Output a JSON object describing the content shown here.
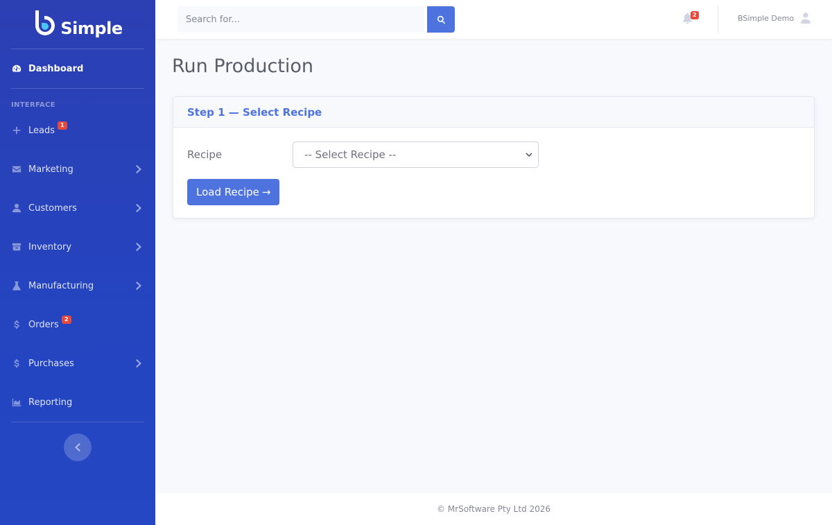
{
  "brand": {
    "name": "Simple"
  },
  "sidebar": {
    "dashboard": {
      "label": "Dashboard",
      "icon": "tachometer-icon"
    },
    "section_heading": "INTERFACE",
    "items": [
      {
        "label": "Leads",
        "icon": "plus-icon",
        "badge": "1",
        "chevron": false
      },
      {
        "label": "Marketing",
        "icon": "envelope-icon",
        "badge": "",
        "chevron": true
      },
      {
        "label": "Customers",
        "icon": "user-icon",
        "badge": "",
        "chevron": true
      },
      {
        "label": "Inventory",
        "icon": "box-icon",
        "badge": "",
        "chevron": true
      },
      {
        "label": "Manufacturing",
        "icon": "flask-icon",
        "badge": "",
        "chevron": true
      },
      {
        "label": "Orders",
        "icon": "dollar-icon",
        "badge": "2",
        "chevron": false
      },
      {
        "label": "Purchases",
        "icon": "dollar-icon",
        "badge": "",
        "chevron": true
      },
      {
        "label": "Reporting",
        "icon": "chart-area-icon",
        "badge": "",
        "chevron": false
      }
    ]
  },
  "topbar": {
    "search_placeholder": "Search for...",
    "notifications_count": "2",
    "user_name": "BSimple Demo"
  },
  "main": {
    "page_title": "Run Production",
    "card": {
      "title": "Step 1 — Select Recipe",
      "recipe_label": "Recipe",
      "recipe_select_value": "-- Select Recipe --",
      "load_button": "Load Recipe",
      "load_button_arrow": "→"
    }
  },
  "footer": {
    "text": "© MrSoftware Pty Ltd 2026"
  },
  "colors": {
    "primary": "#4e73df",
    "sidebar": "#2c3fb3",
    "badge": "#e74a3b"
  }
}
